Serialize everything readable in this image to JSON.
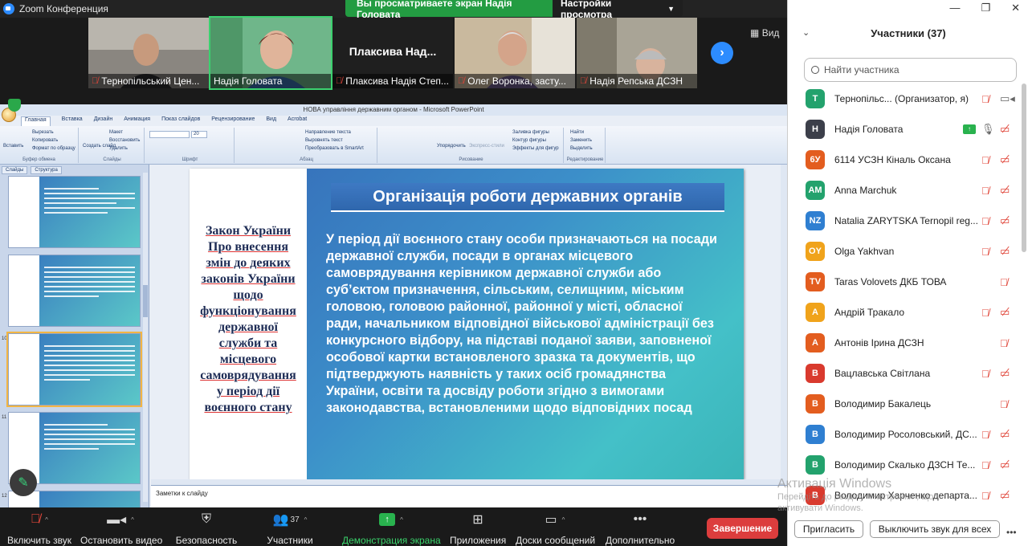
{
  "window": {
    "title": "Zoom Конференция"
  },
  "banner": {
    "viewing": "Вы просматриваете экран Надія Головата",
    "view_options": "Настройки просмотра"
  },
  "strip": {
    "view_label": "Вид",
    "tiles": [
      {
        "name": "Тернопільський Цен...",
        "muted": true
      },
      {
        "name": "Надія Головата",
        "muted": false
      },
      {
        "name": "Плаксива Надія Степ...",
        "muted": true,
        "big_name": "Плаксива Над..."
      },
      {
        "name": "Олег Воронка, засту...",
        "muted": true
      },
      {
        "name": "Надія Репська ДСЗН",
        "muted": true
      }
    ]
  },
  "ppt": {
    "window_title": "НОВА управління державним органом - Microsoft PowerPoint",
    "tabs": [
      "Главная",
      "Вставка",
      "Дизайн",
      "Анимация",
      "Показ слайдов",
      "Рецензирование",
      "Вид",
      "Acrobat"
    ],
    "ribbon": {
      "groups": [
        "Буфер обмена",
        "Слайды",
        "Шрифт",
        "Абзац",
        "Рисование",
        "Редактирование"
      ],
      "items": [
        "Вставить",
        "Вырезать",
        "Копировать",
        "Формат по образцу",
        "Создать слайд",
        "Макет",
        "Восстановить",
        "Удалить",
        "Направление текста",
        "Выровнять текст",
        "Преобразовать в SmartArt",
        "Упорядочить",
        "Экспресс-стили",
        "Заливка фигуры",
        "Контур фигуры",
        "Эффекты для фигур",
        "Найти",
        "Заменить",
        "Выделить"
      ],
      "font_size": "20"
    },
    "side_tabs": [
      "Слайды",
      "Структура"
    ],
    "thumbs": [
      {
        "num": "",
        "title": "Організація роботи державних органів"
      },
      {
        "num": "",
        "title": "Організація роботи державних органів"
      },
      {
        "num": "10",
        "title": ""
      },
      {
        "num": "11",
        "title": ""
      },
      {
        "num": "12",
        "title": "Організація роботи державних органів"
      }
    ],
    "notes_placeholder": "Заметки к слайду"
  },
  "slide": {
    "title": "Організація роботи державних органів",
    "left_text": "Закон України Про внесення змін до деяких законів України щодо функціонування державної служби та місцевого самоврядування у період дії воєнного стану",
    "body": "У період дії воєнного стану особи призначаються на посади державної служби, посади в органах місцевого самоврядування керівником державної служби або суб’єктом призначення, сільським, селищним, міським головою, головою районної, районної у місті, обласної ради, начальником відповідної військової адміністрації без конкурсного відбору, на підставі поданої заяви, заповненої особової картки встановленого зразка та документів, що підтверджують наявність у таких осіб громадянства України, освіти та досвіду роботи згідно з вимогами законодавства, встановленими щодо відповідних посад"
  },
  "toolbar": {
    "mic": "Включить звук",
    "video": "Остановить видео",
    "security": "Безопасность",
    "participants": "Участники",
    "participants_count": "37",
    "share": "Демонстрация экрана",
    "apps": "Приложения",
    "whiteboard": "Доски сообщений",
    "more": "Дополнительно",
    "end": "Завершение"
  },
  "panel": {
    "title": "Участники (37)",
    "search_placeholder": "Найти участника",
    "invite": "Пригласить",
    "mute_all": "Выключить звук для всех",
    "participants": [
      {
        "initials": "T",
        "color": "#23a26d",
        "name": "Тернопільс... (Организатор, я)",
        "mic": "muted",
        "cam": "on"
      },
      {
        "initials": "Н",
        "color": "#3c3f4a",
        "name": "Надія Головата",
        "mic": "on",
        "cam": "off",
        "sharing": true
      },
      {
        "initials": "6У",
        "color": "#e35d1f",
        "name": "6114 УСЗН Кіналь Оксана",
        "mic": "muted",
        "cam": "off"
      },
      {
        "initials": "AM",
        "color": "#23a26d",
        "name": "Anna Marchuk",
        "mic": "muted",
        "cam": "off"
      },
      {
        "initials": "NZ",
        "color": "#2f7fd1",
        "name": "Natalia ZARYTSKA Ternopil reg...",
        "mic": "muted",
        "cam": "off"
      },
      {
        "initials": "OY",
        "color": "#f0a31b",
        "name": "Olga Yakhvan",
        "mic": "muted",
        "cam": "off"
      },
      {
        "initials": "TV",
        "color": "#e35d1f",
        "name": "Taras Volovets ДКБ ТОВА",
        "mic": "muted",
        "cam": "none"
      },
      {
        "initials": "А",
        "color": "#f0a31b",
        "name": "Андрій Тракало",
        "mic": "muted",
        "cam": "off"
      },
      {
        "initials": "А",
        "color": "#e35d1f",
        "name": "Антонів Ірина ДСЗН",
        "mic": "muted",
        "cam": "none"
      },
      {
        "initials": "В",
        "color": "#d93a2e",
        "name": "Вацлавська Світлана",
        "mic": "muted",
        "cam": "off"
      },
      {
        "initials": "В",
        "color": "#e35d1f",
        "name": "Володимир Бакалець",
        "mic": "muted",
        "cam": "none"
      },
      {
        "initials": "В",
        "color": "#2f7fd1",
        "name": "Володимир Росоловський, ДС...",
        "mic": "muted",
        "cam": "off"
      },
      {
        "initials": "В",
        "color": "#23a26d",
        "name": "Володимир Скалько ДЗСН Те...",
        "mic": "muted",
        "cam": "off"
      },
      {
        "initials": "В",
        "color": "#d93a2e",
        "name": "Володимир Харченко департа...",
        "mic": "muted",
        "cam": "off"
      }
    ]
  },
  "watermark": {
    "title": "Активація Windows",
    "line2": "Перейдіть до розділу \"Настройки\", щоб",
    "line3": "активувати Windows."
  }
}
